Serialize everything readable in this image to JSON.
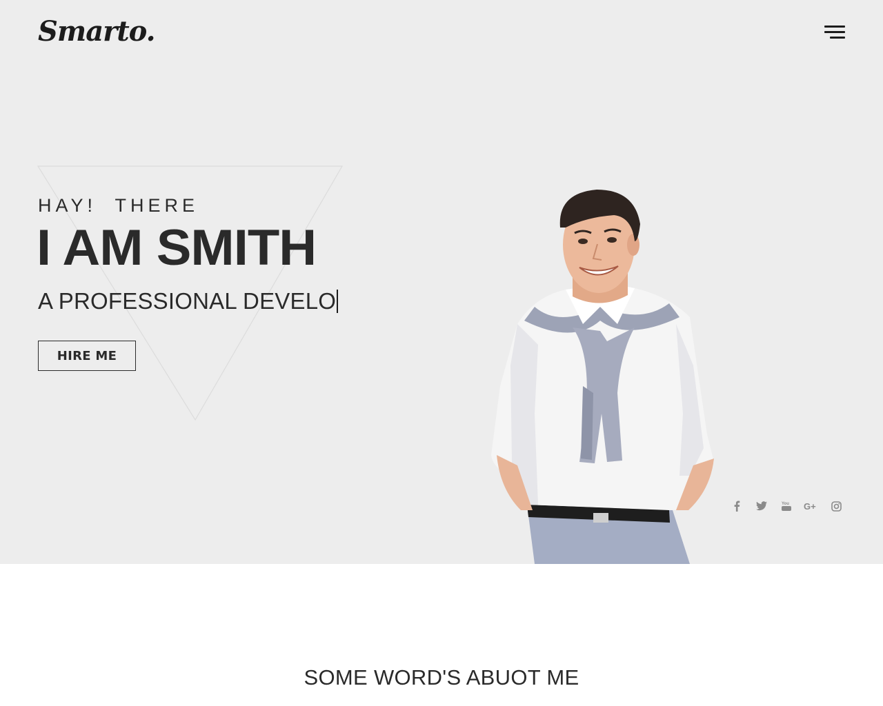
{
  "header": {
    "logo": "Smarto.",
    "menu_icon": "hamburger-menu-icon"
  },
  "hero": {
    "greeting": "HAY!  THERE",
    "headline": "I AM SMITH",
    "typed_text": "A PROFESSIONAL DEVELO",
    "hire_button": "HIRE ME",
    "background_color": "#ededed",
    "text_color": "#2a2a2a"
  },
  "socials": [
    {
      "name": "facebook-icon",
      "glyph": "f"
    },
    {
      "name": "twitter-icon",
      "glyph": "bird"
    },
    {
      "name": "youtube-icon",
      "glyph": "You"
    },
    {
      "name": "google-plus-icon",
      "glyph": "G+"
    },
    {
      "name": "instagram-icon",
      "glyph": "cam"
    }
  ],
  "about": {
    "title": "SOME WORD'S ABUOT ME"
  }
}
